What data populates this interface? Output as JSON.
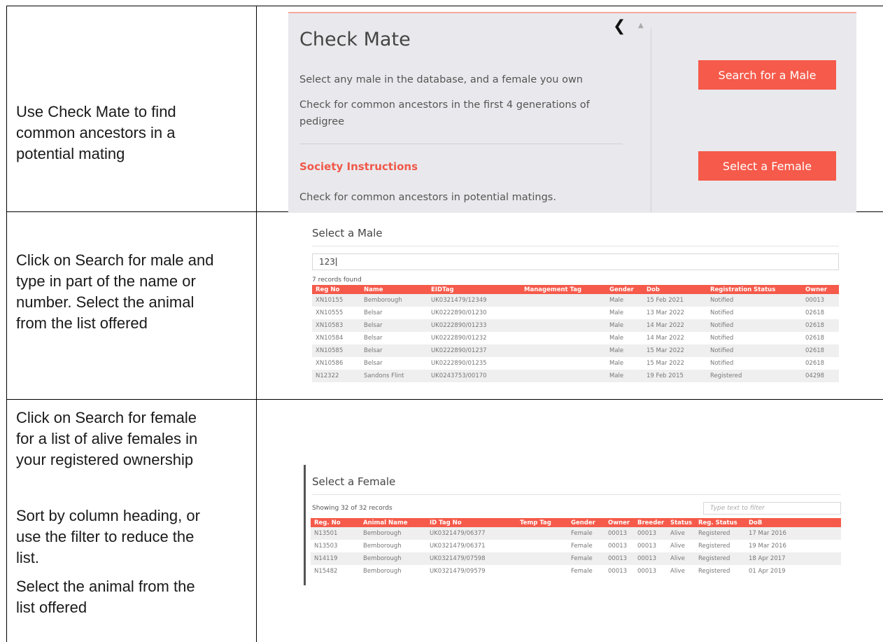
{
  "rows": [
    {
      "description": [
        "Use Check Mate to find",
        "common ancestors in a",
        "potential mating"
      ]
    },
    {
      "description": [
        "Click on Search for male and",
        "type in part of the name or",
        "number. Select the animal",
        "from the list offered"
      ]
    },
    {
      "description_top": [
        "Click on Search for female",
        "for a list of alive females in",
        "your registered ownership"
      ],
      "description_mid": [
        "Sort by column heading,  or",
        "use the filter to reduce the",
        "list."
      ],
      "description_bottom": [
        "Select the animal from the",
        "list offered"
      ]
    }
  ],
  "check_mate": {
    "title": "Check Mate",
    "line1": "Select any male in the database, and a female you own",
    "line2a": "Check for common ancestors in the first 4 generations of",
    "line2b": "pedigree",
    "section_heading": "Society Instructions",
    "section_text": "Check for common ancestors in potential matings.",
    "male_button": "Search for a Male",
    "female_button": "Select a Female",
    "collapse_icon": "chevron-left-icon",
    "accent": "#f55a4a"
  },
  "select_male": {
    "title": "Select a Male",
    "search_value": "123",
    "records_found": "7 records found",
    "columns": [
      "Reg No",
      "Name",
      "EIDTag",
      "Management Tag",
      "Gender",
      "Dob",
      "Registration Status",
      "Owner"
    ],
    "rows": [
      [
        "XN10155",
        "Bemborough",
        "UK0321479/12349",
        "",
        "Male",
        "15 Feb 2021",
        "Notified",
        "00013"
      ],
      [
        "XN10555",
        "Belsar",
        "UK0222890/01230",
        "",
        "Male",
        "13 Mar 2022",
        "Notified",
        "02618"
      ],
      [
        "XN10583",
        "Belsar",
        "UK0222890/01233",
        "",
        "Male",
        "14 Mar 2022",
        "Notified",
        "02618"
      ],
      [
        "XN10584",
        "Belsar",
        "UK0222890/01232",
        "",
        "Male",
        "14 Mar 2022",
        "Notified",
        "02618"
      ],
      [
        "XN10585",
        "Belsar",
        "UK0222890/01237",
        "",
        "Male",
        "15 Mar 2022",
        "Notified",
        "02618"
      ],
      [
        "XN10586",
        "Belsar",
        "UK0222890/01235",
        "",
        "Male",
        "15 Mar 2022",
        "Notified",
        "02618"
      ],
      [
        "N12322",
        "Sandons Flint",
        "UK0243753/00170",
        "",
        "Male",
        "19 Feb 2015",
        "Registered",
        "04298"
      ]
    ]
  },
  "select_female": {
    "title": "Select a Female",
    "showing": "Showing 32 of 32 records",
    "filter_placeholder": "Type text to filter",
    "columns": [
      "Reg. No",
      "Animal Name",
      "ID Tag No",
      "Temp Tag",
      "Gender",
      "Owner",
      "Breeder",
      "Status",
      "Reg. Status",
      "DoB"
    ],
    "rows": [
      [
        "N13501",
        "Bemborough",
        "UK0321479/06377",
        "",
        "Female",
        "00013",
        "00013",
        "Alive",
        "Registered",
        "17 Mar 2016"
      ],
      [
        "N13503",
        "Bemborough",
        "UK0321479/06371",
        "",
        "Female",
        "00013",
        "00013",
        "Alive",
        "Registered",
        "19 Mar 2016"
      ],
      [
        "N14119",
        "Bemborough",
        "UK0321479/07598",
        "",
        "Female",
        "00013",
        "00013",
        "Alive",
        "Registered",
        "18 Apr 2017"
      ],
      [
        "N15482",
        "Bemborough",
        "UK0321479/09579",
        "",
        "Female",
        "00013",
        "00013",
        "Alive",
        "Registered",
        "01 Apr 2019"
      ]
    ]
  }
}
